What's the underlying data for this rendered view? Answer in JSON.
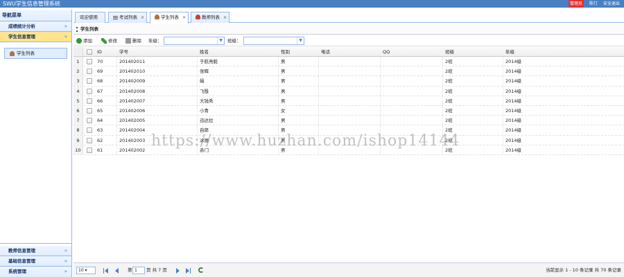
{
  "titlebar": {
    "app_title": "SWU学生信息管理系统",
    "user_badge": "管理员",
    "user_name": "陈仃",
    "logout": "安全退出"
  },
  "sidebar": {
    "title": "导航菜单",
    "collapse_icon": "double-chevron-left-icon",
    "sections": [
      {
        "label": "成绩统计分析",
        "state": "collapsed"
      },
      {
        "label": "学生信息管理",
        "state": "expanded"
      }
    ],
    "items": [
      {
        "label": "学生列表"
      }
    ],
    "bottom_sections": [
      {
        "label": "教师信息管理"
      },
      {
        "label": "基础信息管理"
      },
      {
        "label": "系统管理"
      }
    ]
  },
  "tabs": [
    {
      "label": "欢迎使用",
      "closable": false,
      "active": false
    },
    {
      "label": "考试列表",
      "closable": true,
      "active": false
    },
    {
      "label": "学生列表",
      "closable": true,
      "active": true
    },
    {
      "label": "教师列表",
      "closable": true,
      "active": false
    }
  ],
  "panel": {
    "title": "学生列表"
  },
  "toolbar": {
    "add": "添加",
    "edit": "修改",
    "delete": "删除",
    "grade_label": "年级：",
    "class_label": "班级："
  },
  "grid": {
    "columns": [
      "ID",
      "学号",
      "姓名",
      "性别",
      "电话",
      "QQ",
      "班级",
      "年级"
    ],
    "rows": [
      [
        "1",
        "70",
        "201402011",
        "于航亮毅",
        "男",
        "",
        "",
        "2班",
        "2014级"
      ],
      [
        "2",
        "69",
        "201402010",
        "张辉",
        "男",
        "",
        "",
        "2班",
        "2014级"
      ],
      [
        "3",
        "68",
        "201402009",
        "娟",
        "男",
        "",
        "",
        "2班",
        "2014级"
      ],
      [
        "4",
        "67",
        "201402008",
        "飞殷",
        "男",
        "",
        "",
        "2班",
        "2014级"
      ],
      [
        "5",
        "66",
        "201402007",
        "大钱秀",
        "男",
        "",
        "",
        "2班",
        "2014级"
      ],
      [
        "6",
        "65",
        "201402006",
        "小青",
        "女",
        "",
        "",
        "2班",
        "2014级"
      ],
      [
        "7",
        "64",
        "201402005",
        "迅达拉",
        "男",
        "",
        "",
        "2班",
        "2014级"
      ],
      [
        "8",
        "63",
        "201402004",
        "自郎",
        "男",
        "",
        "",
        "2班",
        "2014级"
      ],
      [
        "9",
        "62",
        "201402003",
        "冰丽",
        "男",
        "",
        "",
        "2班",
        "2014级"
      ],
      [
        "10",
        "61",
        "201402002",
        "赤门",
        "男",
        "",
        "",
        "2班",
        "2014级"
      ]
    ]
  },
  "pager": {
    "page_size": "10",
    "page_prefix": "第",
    "page_value": "1",
    "page_suffix": "页 共 7 页",
    "summary": "当前显示 1 - 10 条记录 共 70 条记录"
  },
  "watermark": "https://www.huzhan.com/ishop14144"
}
